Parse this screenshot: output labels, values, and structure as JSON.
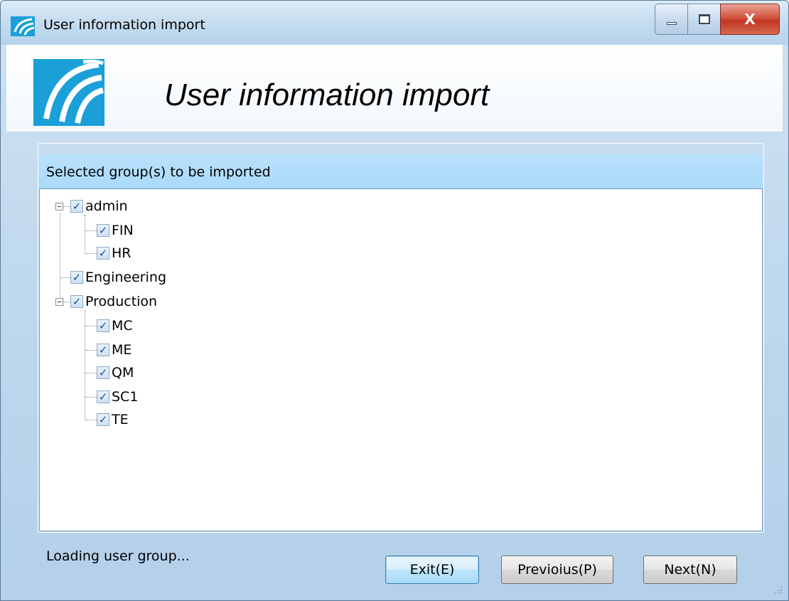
{
  "window": {
    "title": "User information import",
    "close_glyph": "X"
  },
  "header": {
    "title": "User information import"
  },
  "group_box": {
    "label": "Selected group(s) to be imported"
  },
  "tree": {
    "check_glyph": "✓",
    "nodes": [
      {
        "label": "admin",
        "checked": true
      },
      {
        "label": "FIN",
        "checked": true
      },
      {
        "label": "HR",
        "checked": true
      },
      {
        "label": "Engineering",
        "checked": true
      },
      {
        "label": "Production",
        "checked": true
      },
      {
        "label": "MC",
        "checked": true
      },
      {
        "label": "ME",
        "checked": true
      },
      {
        "label": "QM",
        "checked": true
      },
      {
        "label": "SC1",
        "checked": true
      },
      {
        "label": "TE",
        "checked": true
      }
    ]
  },
  "status": {
    "text": "Loading user group..."
  },
  "buttons": {
    "exit": "Exit(E)",
    "previous": "Previoius(P)",
    "next": "Next(N)"
  },
  "icons": {
    "app": "app-logo-icon",
    "minimize": "minimize-icon",
    "maximize": "maximize-icon",
    "close": "close-icon",
    "expander": "collapse-icon",
    "checkbox": "checkbox-checked-icon",
    "grip": "resize-grip-icon"
  },
  "colors": {
    "accent": "#a9dafb",
    "logo": "#1a9fd8"
  }
}
